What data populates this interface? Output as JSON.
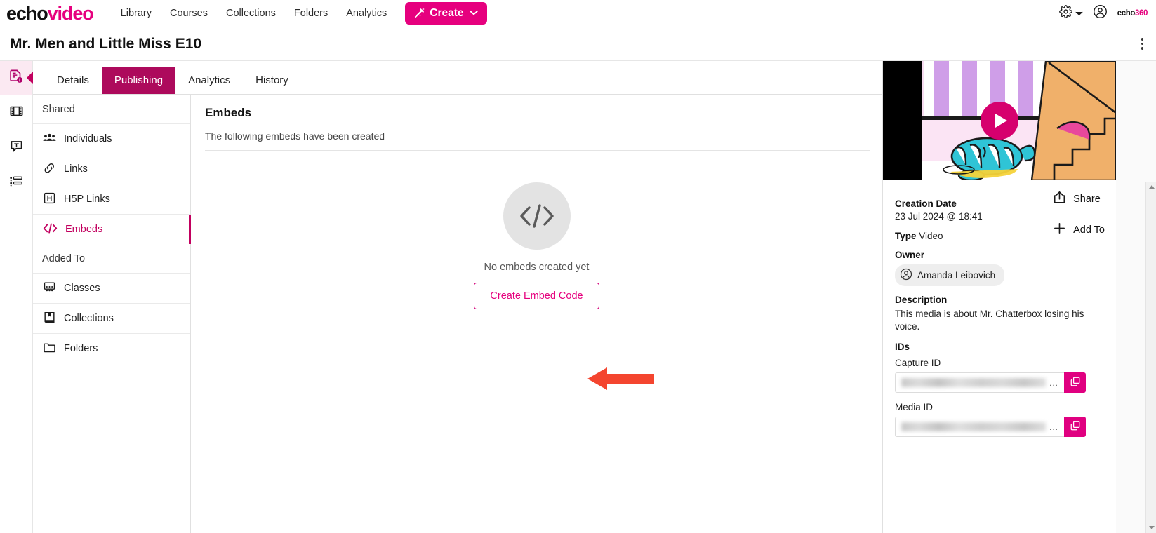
{
  "topnav": {
    "logo_echo": "echo",
    "logo_video": "video",
    "links": [
      {
        "label": "Library",
        "name": "nav-library"
      },
      {
        "label": "Courses",
        "name": "nav-courses"
      },
      {
        "label": "Collections",
        "name": "nav-collections"
      },
      {
        "label": "Folders",
        "name": "nav-folders"
      },
      {
        "label": "Analytics",
        "name": "nav-analytics"
      }
    ],
    "create_label": "Create",
    "create_icon": "magic-wand-icon",
    "settings_icon": "gear-icon",
    "account_icon": "user-account-icon",
    "brand_echo": "echo",
    "brand_360": "360"
  },
  "header": {
    "title": "Mr. Men and Little Miss E10",
    "more_icon": "kebab-menu-icon"
  },
  "rail": {
    "items": [
      {
        "name": "rail-item-details",
        "icon": "document-info-icon",
        "active": true
      },
      {
        "name": "rail-item-media",
        "icon": "film-strip-icon",
        "active": false
      },
      {
        "name": "rail-item-transcript",
        "icon": "text-bubble-icon",
        "active": false
      },
      {
        "name": "rail-item-index",
        "icon": "list-icon",
        "active": false
      }
    ]
  },
  "tabs": [
    {
      "label": "Details",
      "active": false
    },
    {
      "label": "Publishing",
      "active": true
    },
    {
      "label": "Analytics",
      "active": false
    },
    {
      "label": "History",
      "active": false
    }
  ],
  "sidebar": {
    "groups": [
      {
        "heading": "Shared",
        "items": [
          {
            "label": "Individuals",
            "icon": "people-icon",
            "active": false
          },
          {
            "label": "Links",
            "icon": "link-chain-icon",
            "active": false
          },
          {
            "label": "H5P Links",
            "icon": "h5p-icon",
            "active": false
          },
          {
            "label": "Embeds",
            "icon": "code-brackets-icon",
            "active": true
          }
        ]
      },
      {
        "heading": "Added To",
        "items": [
          {
            "label": "Classes",
            "icon": "classroom-icon",
            "active": false
          },
          {
            "label": "Collections",
            "icon": "book-icon",
            "active": false
          },
          {
            "label": "Folders",
            "icon": "folder-icon",
            "active": false
          }
        ]
      }
    ]
  },
  "main": {
    "title": "Embeds",
    "subtitle": "The following embeds have been created",
    "empty_icon": "code-brackets-icon",
    "empty_glyph": "</>",
    "empty_text": "No embeds created yet",
    "create_embed_label": "Create Embed Code",
    "annotation": "red-arrow-pointing-left"
  },
  "right_panel": {
    "thumbnail": {
      "name": "video-thumbnail",
      "play_icon": "play-button-icon"
    },
    "actions": [
      {
        "label": "Share",
        "icon": "share-icon"
      },
      {
        "label": "Add To",
        "icon": "plus-icon"
      }
    ],
    "creation_date_label": "Creation Date",
    "creation_date_value": "23 Jul 2024 @ 18:41",
    "type_label": "Type",
    "type_value": "Video",
    "owner_label": "Owner",
    "owner_name": "Amanda Leibovich",
    "owner_icon": "user-avatar-icon",
    "description_label": "Description",
    "description_value": "This media is about Mr. Chatterbox losing his voice.",
    "ids_label": "IDs",
    "capture_id_label": "Capture ID",
    "capture_id_value": "",
    "media_id_label": "Media ID",
    "media_id_value": "",
    "copy_icon": "copy-icon",
    "ellipsis": "..."
  },
  "colors": {
    "brand_magenta": "#e6007e",
    "tab_active": "#ad0a5c",
    "accent_link": "#c2005f",
    "annotation_red": "#f4452f"
  }
}
